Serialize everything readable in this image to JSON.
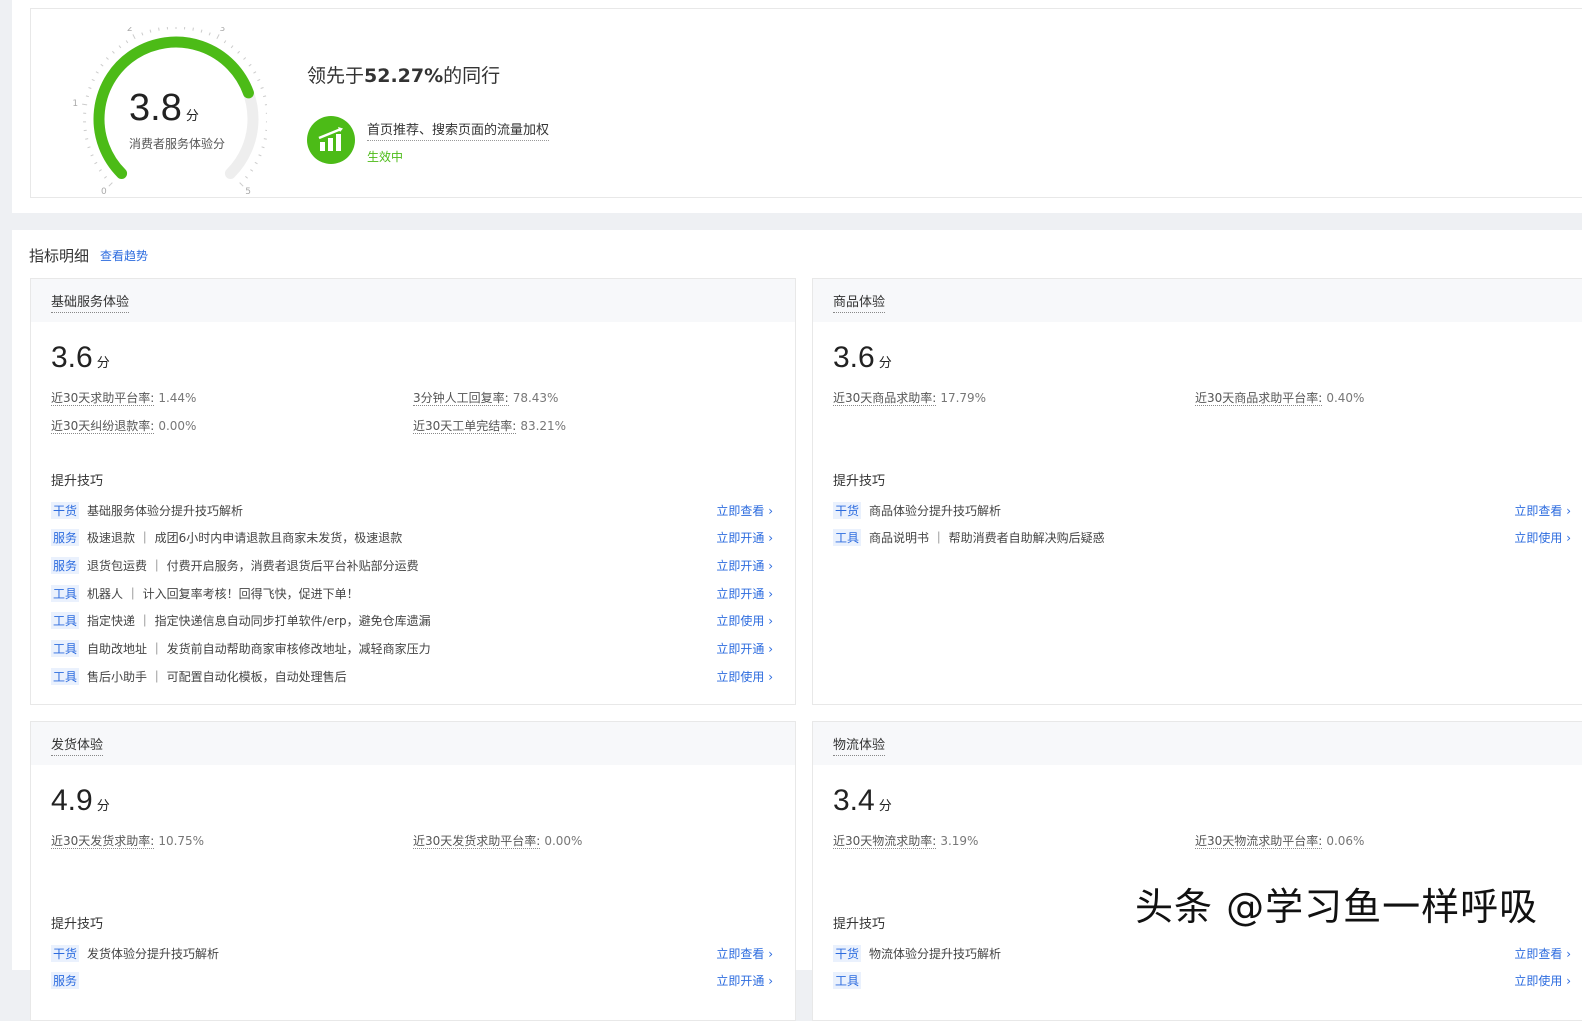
{
  "overview": {
    "score": "3.8",
    "score_value": 3.8,
    "score_max": 5,
    "unit": "分",
    "label": "消费者服务体验分",
    "ticks": [
      "0",
      "1",
      "2",
      "3",
      "4",
      "5"
    ],
    "lead_prefix": "领先于",
    "lead_percent": "52.27%",
    "lead_suffix": "的同行",
    "benefit": "首页推荐、搜索页面的流量加权",
    "benefit_status": "生效中",
    "accent": "#4cbb17"
  },
  "detail": {
    "title": "指标明细",
    "trend_link": "查看趋势",
    "cards": [
      {
        "title": "基础服务体验",
        "score": "3.6",
        "unit": "分",
        "metrics": [
          {
            "label": "近30天求助平台率:",
            "value": "1.44%"
          },
          {
            "label": "3分钟人工回复率:",
            "value": "78.43%"
          },
          {
            "label": "近30天纠纷退款率:",
            "value": "0.00%"
          },
          {
            "label": "近30天工单完结率:",
            "value": "83.21%"
          }
        ],
        "tips_title": "提升技巧",
        "tips": [
          {
            "tag": "干货",
            "text": "基础服务体验分提升技巧解析",
            "action": "立即查看"
          },
          {
            "tag": "服务",
            "text": "极速退款 ｜ 成团6小时内申请退款且商家未发货，极速退款",
            "action": "立即开通"
          },
          {
            "tag": "服务",
            "text": "退货包运费 ｜ 付费开启服务，消费者退货后平台补贴部分运费",
            "action": "立即开通"
          },
          {
            "tag": "工具",
            "text": "机器人 ｜ 计入回复率考核！回得飞快，促进下单！",
            "action": "立即开通"
          },
          {
            "tag": "工具",
            "text": "指定快递 ｜ 指定快递信息自动同步打单软件/erp，避免仓库遗漏",
            "action": "立即使用"
          },
          {
            "tag": "工具",
            "text": "自助改地址 ｜ 发货前自动帮助商家审核修改地址，减轻商家压力",
            "action": "立即开通"
          },
          {
            "tag": "工具",
            "text": "售后小助手 ｜ 可配置自动化模板，自动处理售后",
            "action": "立即使用"
          }
        ]
      },
      {
        "title": "商品体验",
        "score": "3.6",
        "unit": "分",
        "metrics": [
          {
            "label": "近30天商品求助率:",
            "value": "17.79%"
          },
          {
            "label": "近30天商品求助平台率:",
            "value": "0.40%"
          }
        ],
        "tips_title": "提升技巧",
        "tips": [
          {
            "tag": "干货",
            "text": "商品体验分提升技巧解析",
            "action": "立即查看"
          },
          {
            "tag": "工具",
            "text": "商品说明书 ｜ 帮助消费者自助解决购后疑惑",
            "action": "立即使用"
          }
        ]
      },
      {
        "title": "发货体验",
        "score": "4.9",
        "unit": "分",
        "metrics": [
          {
            "label": "近30天发货求助率:",
            "value": "10.75%"
          },
          {
            "label": "近30天发货求助平台率:",
            "value": "0.00%"
          }
        ],
        "tips_title": "提升技巧",
        "tips": [
          {
            "tag": "干货",
            "text": "发货体验分提升技巧解析",
            "action": "立即查看"
          },
          {
            "tag": "服务",
            "text": "",
            "action": "立即开通"
          }
        ]
      },
      {
        "title": "物流体验",
        "score": "3.4",
        "unit": "分",
        "metrics": [
          {
            "label": "近30天物流求助率:",
            "value": "3.19%"
          },
          {
            "label": "近30天物流求助平台率:",
            "value": "0.06%"
          }
        ],
        "tips_title": "提升技巧",
        "tips": [
          {
            "tag": "干货",
            "text": "物流体验分提升技巧解析",
            "action": "立即查看"
          },
          {
            "tag": "工具",
            "text": "",
            "action": "立即使用"
          }
        ]
      }
    ]
  },
  "watermark": "头条 @学习鱼一样呼吸"
}
